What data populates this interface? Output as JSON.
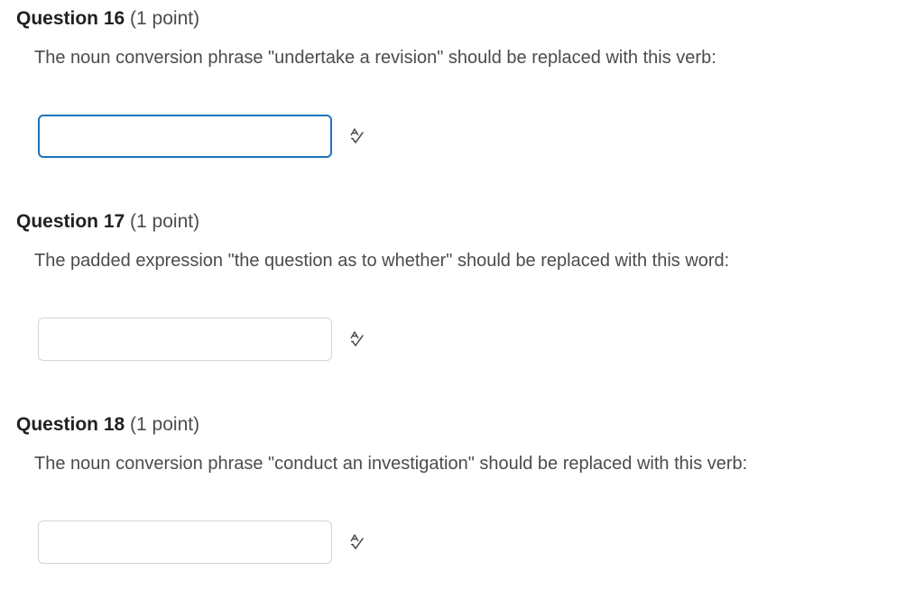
{
  "questions": [
    {
      "title": "Question 16",
      "points": "(1 point)",
      "prompt": "The noun conversion phrase \"undertake a revision\" should be replaced with this verb:",
      "answer_value": "",
      "focused": true,
      "icon": "spellcheck-icon"
    },
    {
      "title": "Question 17",
      "points": "(1 point)",
      "prompt": "The padded expression \"the question as to whether\" should be replaced with this word:",
      "answer_value": "",
      "focused": false,
      "icon": "spellcheck-icon"
    },
    {
      "title": "Question 18",
      "points": "(1 point)",
      "prompt": "The noun conversion phrase \"conduct an investigation\" should be replaced with this verb:",
      "answer_value": "",
      "focused": false,
      "icon": "spellcheck-icon"
    }
  ],
  "colors": {
    "focus_border": "#1e72bd",
    "input_border": "#cdd5dc",
    "text": "#494c4e",
    "heading": "#202122"
  }
}
